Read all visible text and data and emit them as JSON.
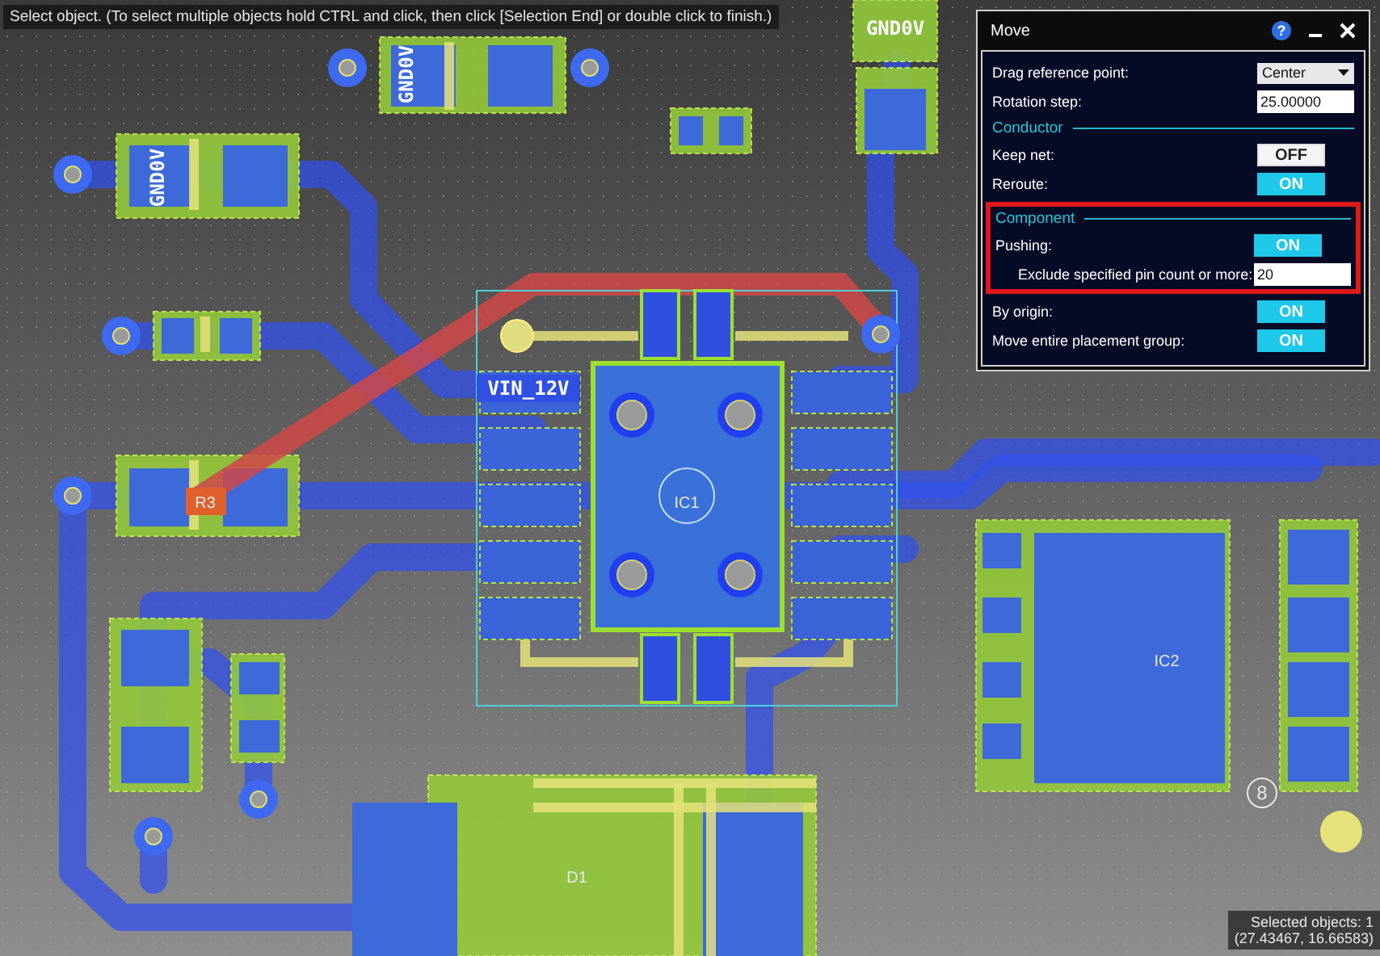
{
  "hint": "Select object. (To select multiple objects hold CTRL and click, then click [Selection End] or double click to finish.)",
  "board": {
    "net_labels": [
      "GND0V",
      "GND0V",
      "GND0V",
      "VIN_12V"
    ],
    "refdes": [
      "R3",
      "IC1",
      "IC2",
      "D1"
    ],
    "marker": "8"
  },
  "panel": {
    "title": "Move",
    "help": "?",
    "groups": [
      {
        "highlighted": false,
        "rows": [
          {
            "kind": "select",
            "label": "Drag reference point:",
            "value": "Center"
          },
          {
            "kind": "input",
            "label": "Rotation step:",
            "value": "25.00000"
          },
          {
            "kind": "section",
            "label": "Conductor"
          },
          {
            "kind": "toggle",
            "label": "Keep net:",
            "on": false,
            "text": "OFF"
          },
          {
            "kind": "toggle",
            "label": "Reroute:",
            "on": true,
            "text": "ON"
          }
        ]
      },
      {
        "highlighted": true,
        "rows": [
          {
            "kind": "section",
            "label": "Component"
          },
          {
            "kind": "toggle",
            "label": "Pushing:",
            "on": true,
            "text": "ON"
          },
          {
            "kind": "subinput",
            "label": "Exclude specified pin count or more:",
            "value": "20"
          }
        ]
      },
      {
        "highlighted": false,
        "rows": [
          {
            "kind": "toggle",
            "label": "By origin:",
            "on": true,
            "text": "ON"
          },
          {
            "kind": "toggle",
            "label": "Move entire placement group:",
            "on": true,
            "text": "ON"
          }
        ]
      }
    ]
  },
  "status": {
    "selected": "Selected objects: 1",
    "coords": "(27.43467, 16.66583)"
  }
}
